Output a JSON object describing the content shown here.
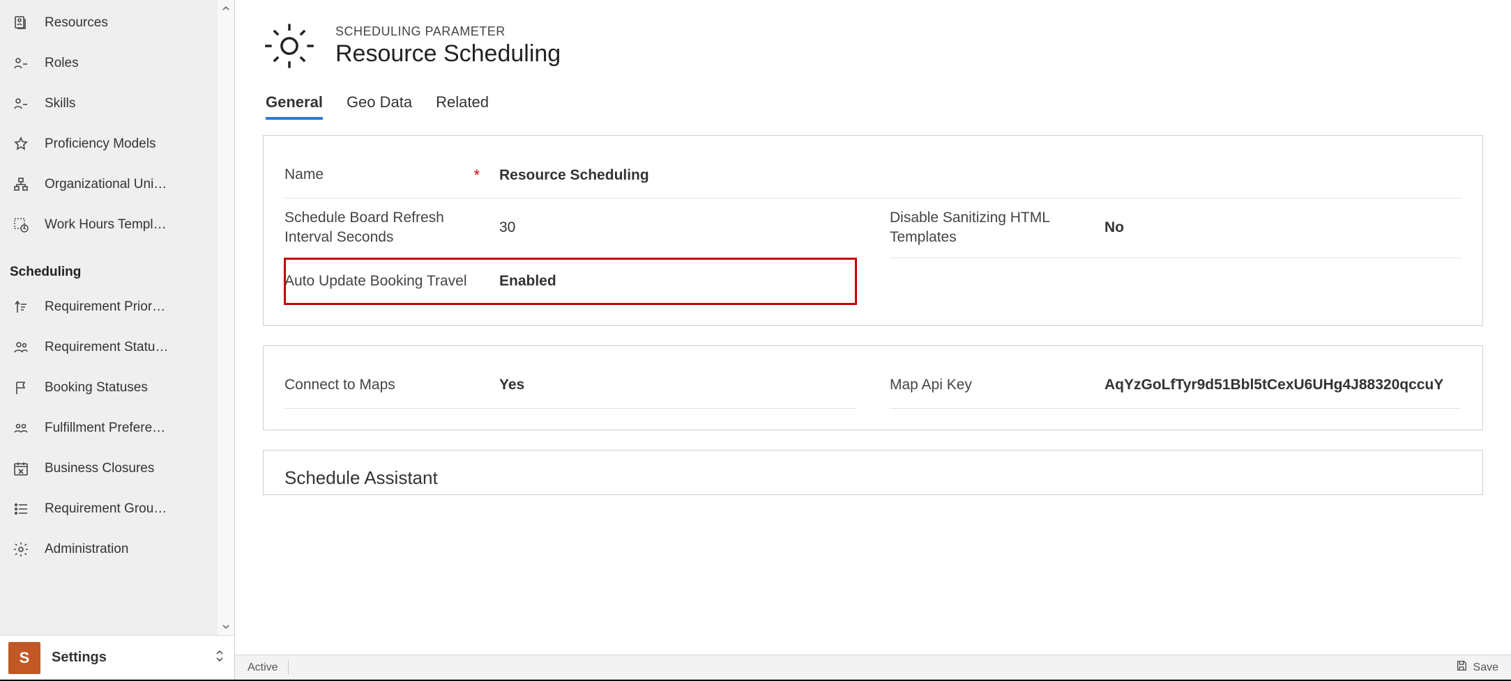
{
  "sidebar": {
    "items_top": [
      {
        "label": "Resources",
        "icon": "resource-icon"
      },
      {
        "label": "Roles",
        "icon": "roles-icon"
      },
      {
        "label": "Skills",
        "icon": "roles-icon"
      },
      {
        "label": "Proficiency Models",
        "icon": "star-icon"
      },
      {
        "label": "Organizational Uni…",
        "icon": "org-icon"
      },
      {
        "label": "Work Hours Templ…",
        "icon": "clock-box-icon"
      }
    ],
    "group_header": "Scheduling",
    "items_sched": [
      {
        "label": "Requirement Prior…",
        "icon": "priority-icon"
      },
      {
        "label": "Requirement Statu…",
        "icon": "people-icon"
      },
      {
        "label": "Booking Statuses",
        "icon": "flag-icon"
      },
      {
        "label": "Fulfillment Prefere…",
        "icon": "group-icon"
      },
      {
        "label": "Business Closures",
        "icon": "calendar-x-icon"
      },
      {
        "label": "Requirement Grou…",
        "icon": "list-icon"
      },
      {
        "label": "Administration",
        "icon": "gear-icon"
      }
    ],
    "area_badge": "S",
    "area_label": "Settings"
  },
  "header": {
    "eyebrow": "SCHEDULING PARAMETER",
    "title": "Resource Scheduling"
  },
  "tabs": [
    {
      "label": "General",
      "active": true
    },
    {
      "label": "Geo Data",
      "active": false
    },
    {
      "label": "Related",
      "active": false
    }
  ],
  "section1": {
    "name_label": "Name",
    "name_value": "Resource Scheduling",
    "refresh_label": "Schedule Board Refresh Interval Seconds",
    "refresh_value": "30",
    "sanitize_label": "Disable Sanitizing HTML Templates",
    "sanitize_value": "No",
    "auto_label": "Auto Update Booking Travel",
    "auto_value": "Enabled"
  },
  "section2": {
    "maps_label": "Connect to Maps",
    "maps_value": "Yes",
    "apikey_label": "Map Api Key",
    "apikey_value": "AqYzGoLfTyr9d51Bbl5tCexU6UHg4J88320qccuY"
  },
  "section3": {
    "title": "Schedule Assistant"
  },
  "statusbar": {
    "state": "Active",
    "save_label": "Save"
  }
}
